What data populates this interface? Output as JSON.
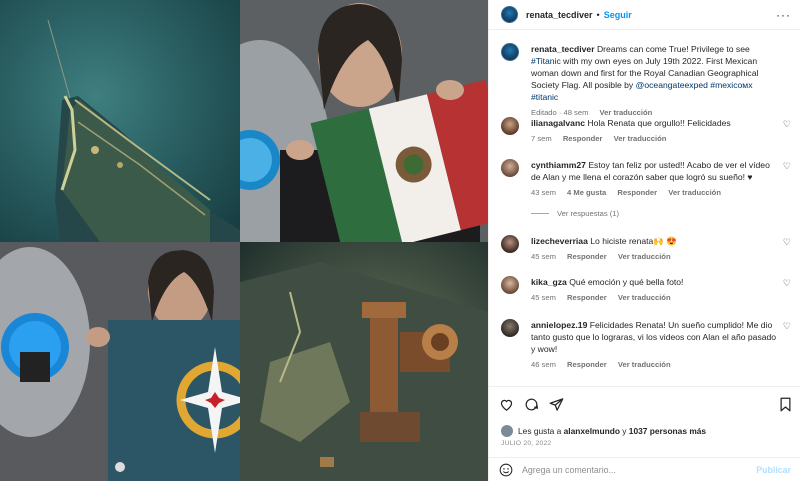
{
  "header": {
    "username": "renata_tecdiver",
    "separator": "•",
    "follow_label": "Seguir",
    "more_glyph": "···"
  },
  "caption": {
    "username": "renata_tecdiver",
    "text_1": "Dreams can come True! Privilege to see",
    "tag_titanic": "#Titanic",
    "text_2": "with my own eyes on July 19th 2022. First Mexican woman down and first for the Royal Canadian Geographical Society Flag. All posible by",
    "mention_1": "@oceangateexped",
    "tag_mexico": "#mexicoмх",
    "tag_titanic2": "#titanic",
    "meta_time": "Editado · 48 sem",
    "meta_translate": "Ver traducción"
  },
  "comments": [
    {
      "username": "ilianagalvanc",
      "text": "Hola Renata que orgullo!! Felicidades",
      "time": "7 sem",
      "reply": "Responder",
      "translate": "Ver traducción",
      "likes": ""
    },
    {
      "username": "cynthiamm27",
      "text": "Estoy tan feliz por usted!! Acabo de ver el vídeo de Alan y me llena el corazón saber que logró su sueño! ♥",
      "time": "43 sem",
      "likes": "4 Me gusta",
      "reply": "Responder",
      "translate": "Ver traducción"
    },
    {
      "username": "lizecheverriaa",
      "text": "Lo hiciste renata🙌 😍",
      "time": "45 sem",
      "reply": "Responder",
      "translate": "Ver traducción",
      "likes": ""
    },
    {
      "username": "kika_gza",
      "text": "Qué emoción y qué bella foto!",
      "time": "45 sem",
      "reply": "Responder",
      "translate": "Ver traducción",
      "likes": ""
    },
    {
      "username": "annielopez.19",
      "text": "Felicidades Renata! Un sueño cumplido! Me dio tanto gusto que lo lograras, vi los videos con Alan el año pasado y wow!",
      "time": "46 sem",
      "reply": "Responder",
      "translate": "Ver traducción",
      "likes": ""
    }
  ],
  "view_replies": "Ver respuestas (1)",
  "likes": {
    "prefix": "Les gusta a",
    "user": "alanxelmundo",
    "middle": "y",
    "count": "1037 personas más"
  },
  "post_date": "JULIO 20, 2022",
  "add_comment": {
    "placeholder": "Agrega un comentario...",
    "publish": "Publicar"
  },
  "colors": {
    "link": "#00376b",
    "follow": "#0095f6",
    "muted": "#737373",
    "heart_red": "#ed4956"
  }
}
